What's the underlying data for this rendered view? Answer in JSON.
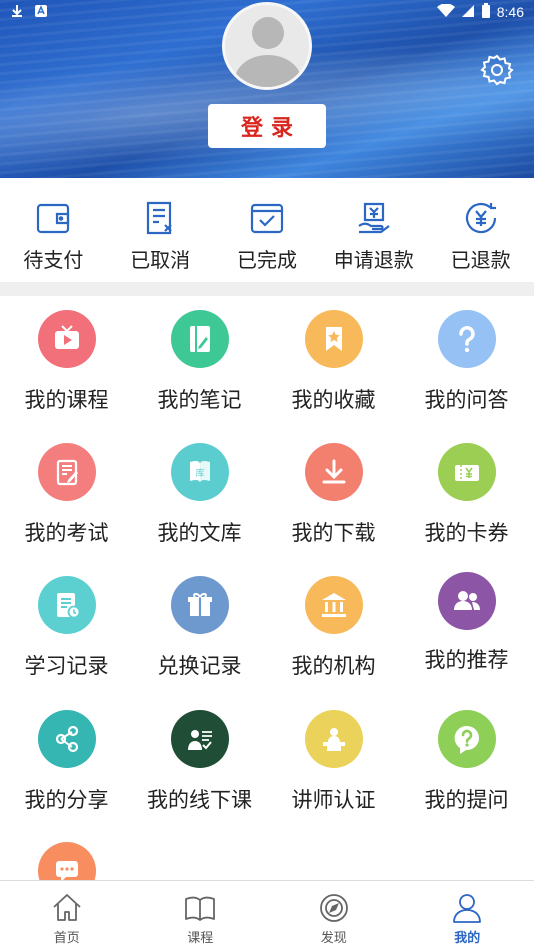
{
  "status_bar": {
    "time": "8:46",
    "icons": [
      "download-icon",
      "app-notification-icon",
      "wifi-icon",
      "cell-signal-icon",
      "battery-icon"
    ]
  },
  "header": {
    "login_label": "登录",
    "settings_icon": "gear-icon",
    "avatar_icon": "default-avatar-icon"
  },
  "orders": [
    {
      "label": "待支付",
      "icon": "wallet-icon"
    },
    {
      "label": "已取消",
      "icon": "cancelled-doc-icon"
    },
    {
      "label": "已完成",
      "icon": "completed-check-icon"
    },
    {
      "label": "申请退款",
      "icon": "refund-request-icon"
    },
    {
      "label": "已退款",
      "icon": "refunded-yen-icon"
    }
  ],
  "grid": [
    {
      "label": "我的课程",
      "icon": "video-tv-icon",
      "color": "#f2707a"
    },
    {
      "label": "我的笔记",
      "icon": "notebook-pen-icon",
      "color": "#3dc896"
    },
    {
      "label": "我的收藏",
      "icon": "bookmark-star-icon",
      "color": "#f8b95a"
    },
    {
      "label": "我的问答",
      "icon": "question-mark-icon",
      "color": "#96c1f4"
    },
    {
      "label": "我的考试",
      "icon": "exam-paper-icon",
      "color": "#f47e7e"
    },
    {
      "label": "我的文库",
      "icon": "library-book-icon",
      "color": "#5ccdcf"
    },
    {
      "label": "我的下载",
      "icon": "download-arrow-icon",
      "color": "#f37f6e"
    },
    {
      "label": "我的卡券",
      "icon": "coupon-ticket-icon",
      "color": "#9bce52"
    },
    {
      "label": "学习记录",
      "icon": "study-record-icon",
      "color": "#5cd0d0"
    },
    {
      "label": "兑换记录",
      "icon": "gift-box-icon",
      "color": "#6e99cf"
    },
    {
      "label": "我的机构",
      "icon": "institution-building-icon",
      "color": "#f8b95a"
    },
    {
      "label": "我的推荐",
      "icon": "people-group-icon",
      "color": "#8d55a6"
    },
    {
      "label": "我的分享",
      "icon": "share-nodes-icon",
      "color": "#35b6b3"
    },
    {
      "label": "我的线下课",
      "icon": "offline-class-teacher-icon",
      "color": "#1f4d35"
    },
    {
      "label": "讲师认证",
      "icon": "lecturer-podium-icon",
      "color": "#ebd25a"
    },
    {
      "label": "我的提问",
      "icon": "question-bubble-icon",
      "color": "#8dcf57"
    },
    {
      "label": "",
      "icon": "chat-message-icon",
      "color": "#f88e5f"
    }
  ],
  "bottom_nav": [
    {
      "label": "首页",
      "icon": "home-icon",
      "active": false
    },
    {
      "label": "课程",
      "icon": "open-book-icon",
      "active": false
    },
    {
      "label": "发现",
      "icon": "compass-icon",
      "active": false
    },
    {
      "label": "我的",
      "icon": "user-profile-icon",
      "active": true
    }
  ],
  "colors": {
    "accent": "#2c67c4",
    "login_text": "#d9251c",
    "order_icon": "#2c67c4",
    "header_blue": "#2f6fd1"
  }
}
